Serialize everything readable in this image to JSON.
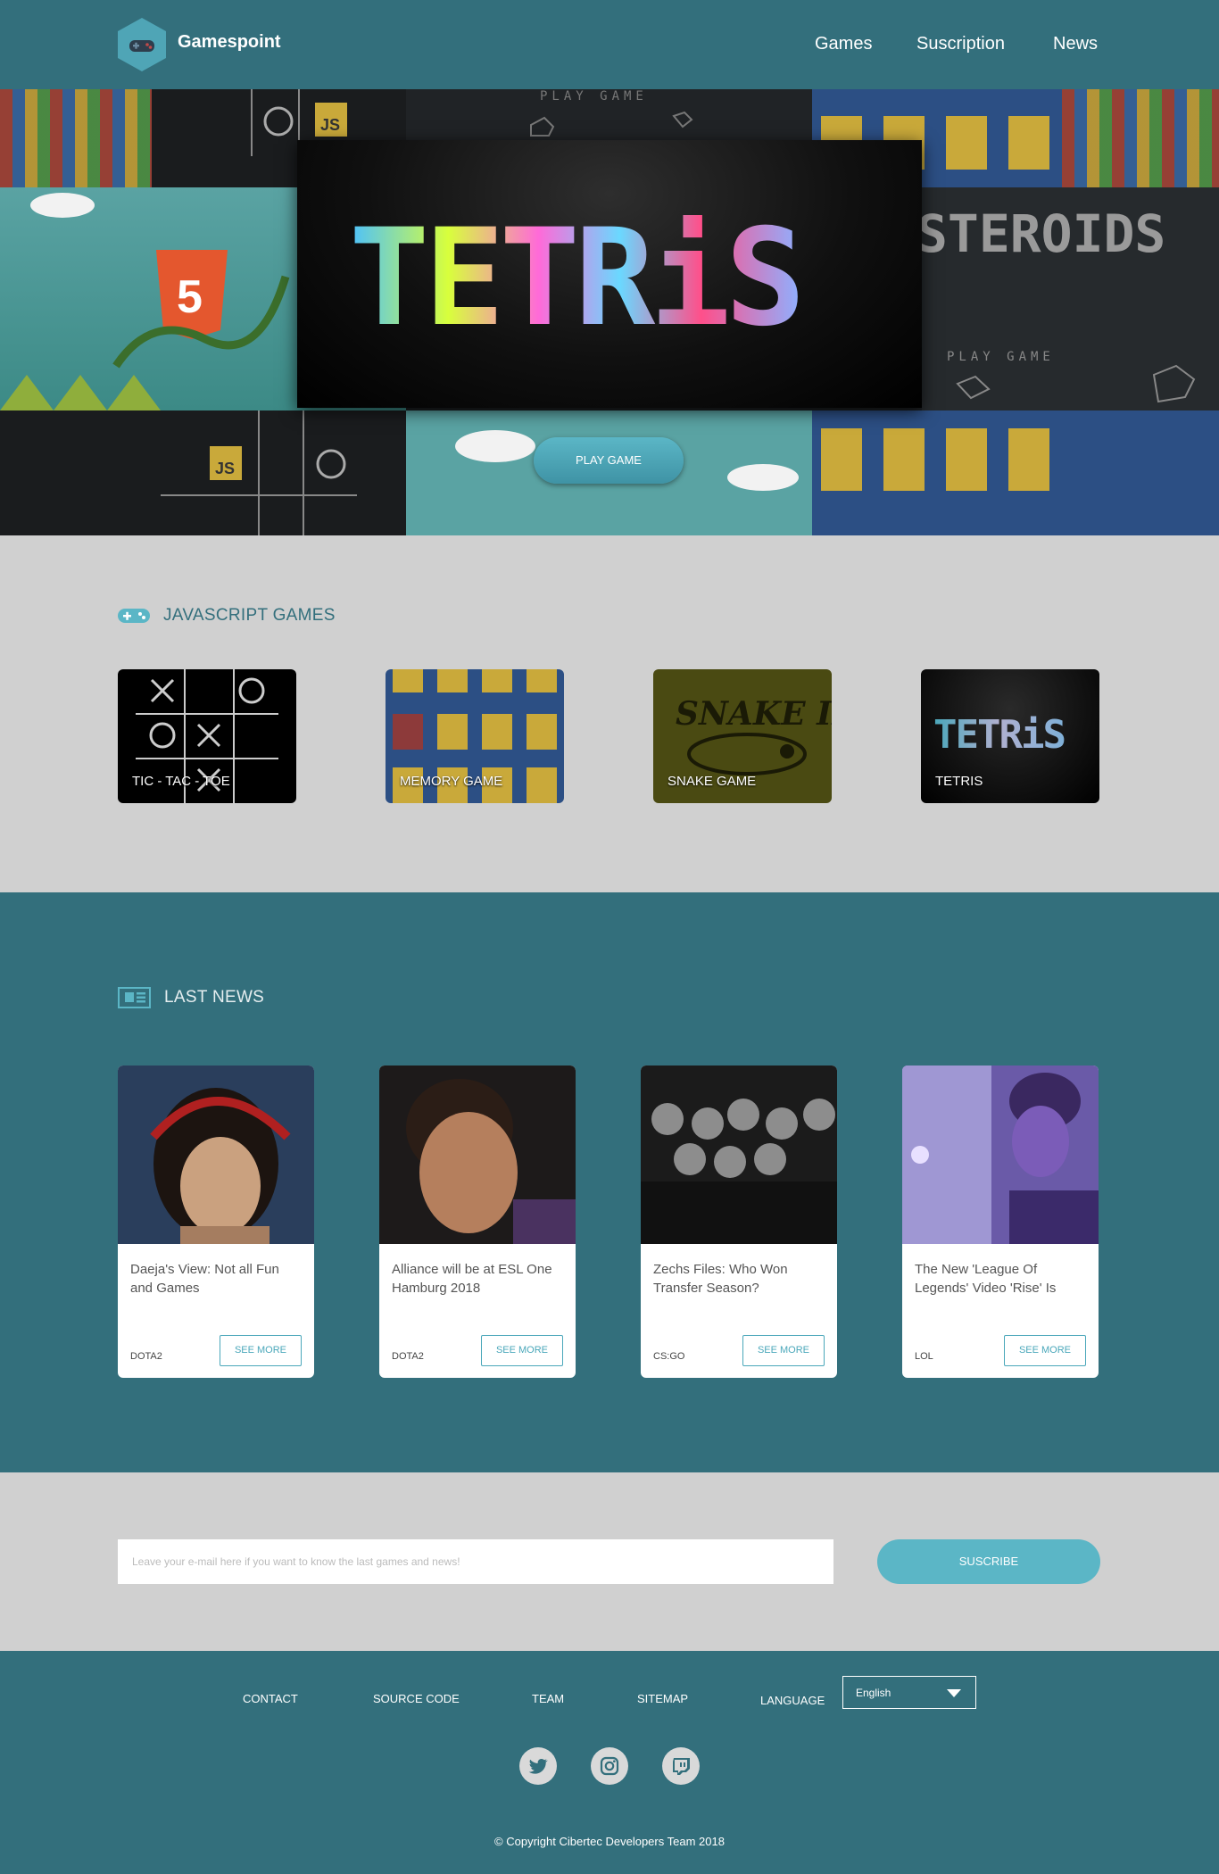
{
  "header": {
    "brand": "Gamespoint",
    "nav": [
      "Games",
      "Suscription",
      "News"
    ]
  },
  "hero": {
    "featured_title": "TETRiS",
    "background_texts": {
      "asteroids": "STEROIDS",
      "play_game": "PLAY GAME",
      "html_badge": "5",
      "js_badge": "JS"
    },
    "play_button": "PLAY GAME"
  },
  "games": {
    "title": "JAVASCRIPT GAMES",
    "items": [
      {
        "label": "TIC - TAC - TOE"
      },
      {
        "label": "MEMORY GAME"
      },
      {
        "label": "SNAKE GAME",
        "art_text": "SNAKE II"
      },
      {
        "label": "TETRIS",
        "art_text": "TETRiS"
      }
    ]
  },
  "news": {
    "title": "LAST NEWS",
    "items": [
      {
        "title": "Daeja's View: Not all Fun and Games",
        "tag": "DOTA2",
        "button": "SEE MORE"
      },
      {
        "title": "Alliance will be at ESL One Hamburg 2018",
        "tag": "DOTA2",
        "button": "SEE MORE"
      },
      {
        "title": "Zechs Files: Who Won Transfer Season?",
        "tag": "CS:GO",
        "button": "SEE MORE"
      },
      {
        "title": "The New 'League Of Legends' Video 'Rise' Is",
        "tag": "LOL",
        "button": "SEE MORE"
      }
    ]
  },
  "subscribe": {
    "placeholder": "Leave your e-mail here if you want to know the last games and news!",
    "button": "SUSCRIBE"
  },
  "footer": {
    "links": [
      "CONTACT",
      "SOURCE CODE",
      "TEAM",
      "SITEMAP"
    ],
    "language_label": "LANGUAGE",
    "language_value": "English",
    "social": [
      "twitter-icon",
      "instagram-icon",
      "twitch-icon"
    ],
    "copyright": "© Copyright Cibertec Developers Team 2018"
  },
  "colors": {
    "primary": "#336f7c",
    "accent": "#5bb6c6",
    "light_bg": "#d0d0d0"
  }
}
